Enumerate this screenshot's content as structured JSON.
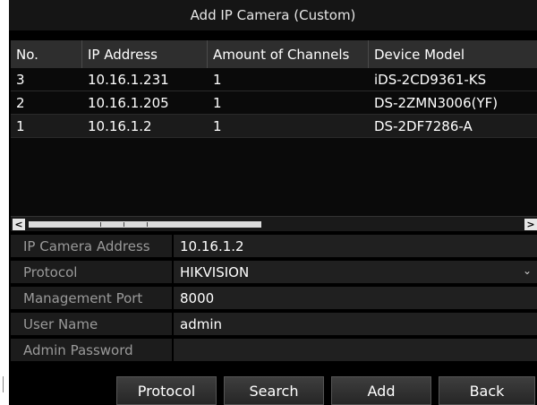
{
  "window": {
    "title": "Add IP Camera (Custom)"
  },
  "grid": {
    "columns": [
      "No.",
      "IP Address",
      "Amount of Channels",
      "Device Model"
    ],
    "rows": [
      [
        "3",
        "10.16.1.231",
        "1",
        "iDS-2CD9361-KS"
      ],
      [
        "2",
        "10.16.1.205",
        "1",
        "DS-2ZMN3006(YF)"
      ],
      [
        "1",
        "10.16.1.2",
        "1",
        "DS-2DF7286-A"
      ]
    ]
  },
  "scrollbar": {
    "left_icon": "arrow-left-icon",
    "right_icon": "arrow-right-icon",
    "left_glyph": "<",
    "right_glyph": ">"
  },
  "form": {
    "ip_address": {
      "label": "IP Camera Address",
      "value": "10.16.1.2"
    },
    "protocol": {
      "label": "Protocol",
      "value": "HIKVISION",
      "arrow_icon": "chevron-down-icon",
      "arrow_glyph": "⌄"
    },
    "port": {
      "label": "Management Port",
      "value": "8000"
    },
    "username": {
      "label": "User Name",
      "value": "admin"
    },
    "password": {
      "label": "Admin Password",
      "value": ""
    }
  },
  "buttons": {
    "protocol": "Protocol",
    "search": "Search",
    "add": "Add",
    "back": "Back"
  },
  "colors": {
    "background": "#000000",
    "titlebar": "#151515",
    "header": "#2e2e2e",
    "label_text": "#9a9a9a",
    "text": "#ffffff"
  }
}
